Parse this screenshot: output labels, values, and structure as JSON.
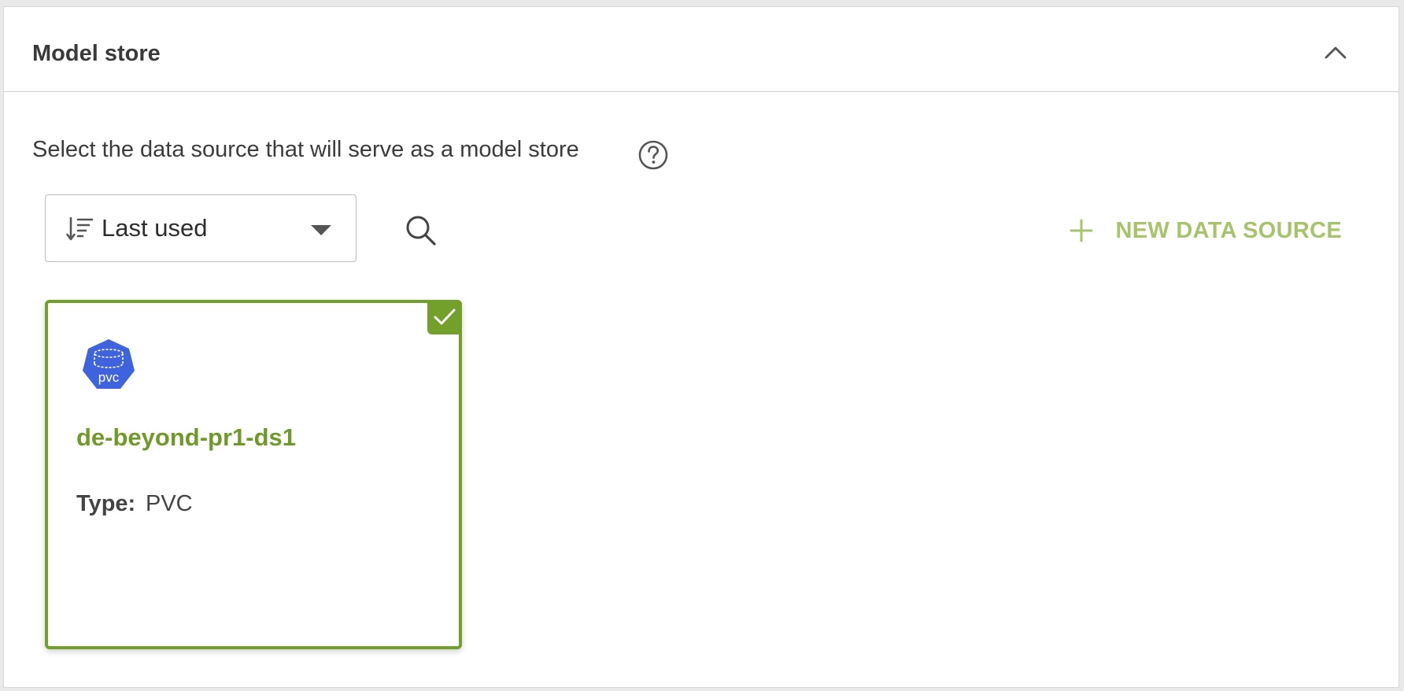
{
  "section": {
    "title": "Model store",
    "description": "Select the data source that will serve as a model store"
  },
  "toolbar": {
    "sort": {
      "selected": "Last used"
    },
    "new_data_source_label": "NEW DATA SOURCE"
  },
  "data_sources": [
    {
      "name": "de-beyond-pr1-ds1",
      "type_label": "Type:",
      "type_value": "PVC",
      "icon_text": "pvc",
      "selected": true
    }
  ],
  "icons": {
    "collapse": "chevron-up-icon",
    "help": "question-circle-icon",
    "sort": "sort-descending-icon",
    "dropdown": "caret-down-icon",
    "search": "search-icon",
    "add": "plus-icon",
    "check": "check-icon",
    "pvc": "pvc-logo-icon"
  },
  "colors": {
    "accent": "#72a02a",
    "accent_light": "#a6c46b",
    "pvc_blue": "#3f63dd"
  }
}
